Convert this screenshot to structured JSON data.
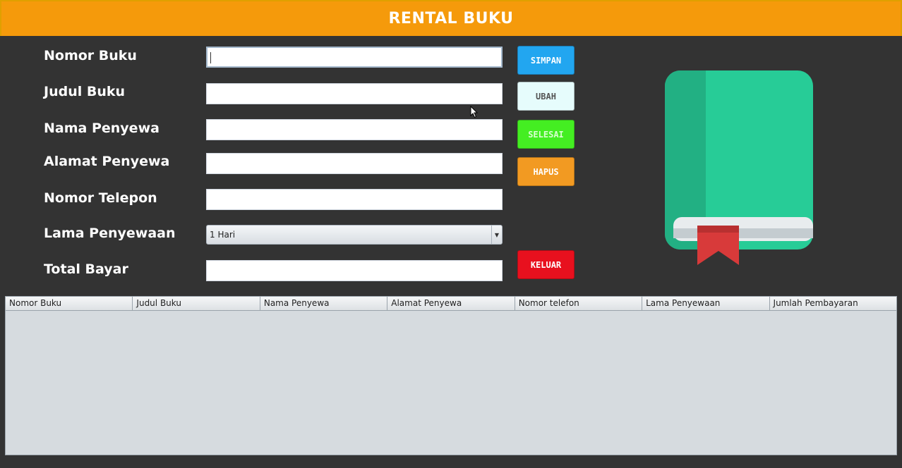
{
  "window": {
    "title": "RENTAL BUKU"
  },
  "form": {
    "labels": {
      "nomor_buku": "Nomor Buku",
      "judul_buku": "Judul Buku",
      "nama_penyewa": "Nama Penyewa",
      "alamat_penyewa": "Alamat Penyewa",
      "nomor_telepon": "Nomor Telepon",
      "lama_penyewaan": "Lama Penyewaan",
      "total_bayar": "Total Bayar"
    },
    "values": {
      "nomor_buku": "",
      "judul_buku": "",
      "nama_penyewa": "",
      "alamat_penyewa": "",
      "nomor_telepon": "",
      "lama_penyewaan": "1 Hari",
      "total_bayar": ""
    }
  },
  "buttons": {
    "simpan": "SIMPAN",
    "ubah": "UBAH",
    "selesai": "SELESAI",
    "hapus": "HAPUS",
    "keluar": "KELUAR"
  },
  "colors": {
    "header": "#f59a0b",
    "simpan": "#22a6f0",
    "ubah": "#e6fcfc",
    "selesai": "#44ee22",
    "hapus": "#f29a22",
    "keluar": "#e8101e",
    "book_cover": "#27cc97",
    "book_spine": "#22b083",
    "bookmark": "#d83a3a"
  },
  "icons": {
    "book": "book-icon"
  },
  "table": {
    "columns": [
      "Nomor Buku",
      "Judul Buku",
      "Nama Penyewa",
      "Alamat Penyewa",
      "Nomor telefon",
      "Lama Penyewaan",
      "Jumlah Pembayaran"
    ],
    "rows": []
  }
}
